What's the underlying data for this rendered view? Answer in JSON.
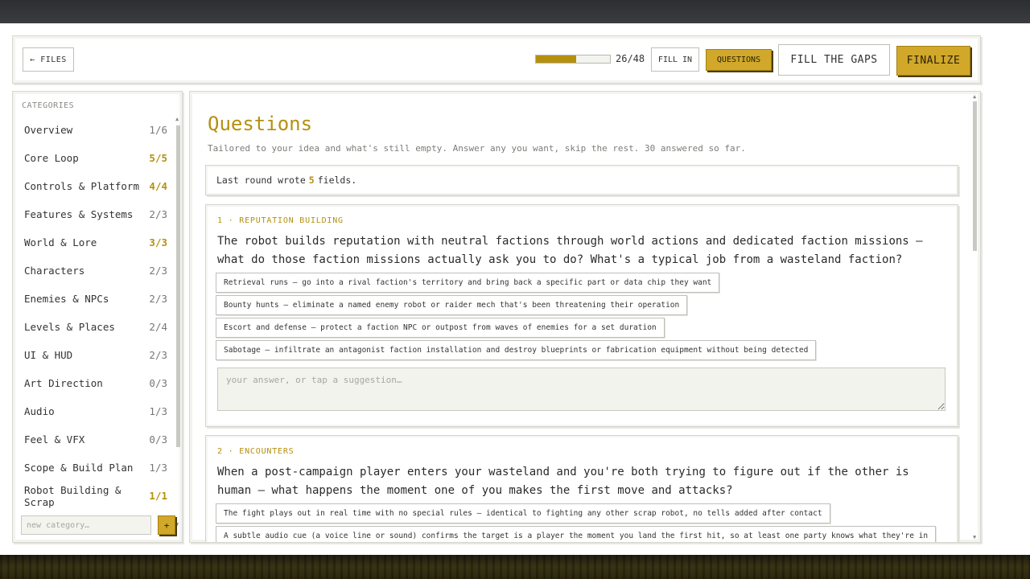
{
  "header": {
    "files_label": "← FILES",
    "progress": {
      "answered": 26,
      "total": 48,
      "label": "26/48",
      "fraction": 0.5417
    },
    "fill_in_label": "FILL IN",
    "questions_label": "QUESTIONS",
    "fill_gaps_label": "FILL THE GAPS",
    "finalize_label": "FINALIZE"
  },
  "colors": {
    "accent": "#d1a82a",
    "accent_text": "#b5900f"
  },
  "sidebar": {
    "title": "CATEGORIES",
    "items": [
      {
        "label": "Overview",
        "count": "1/6",
        "done": false
      },
      {
        "label": "Core Loop",
        "count": "5/5",
        "done": true
      },
      {
        "label": "Controls & Platform",
        "count": "4/4",
        "done": true
      },
      {
        "label": "Features & Systems",
        "count": "2/3",
        "done": false
      },
      {
        "label": "World & Lore",
        "count": "3/3",
        "done": true
      },
      {
        "label": "Characters",
        "count": "2/3",
        "done": false
      },
      {
        "label": "Enemies & NPCs",
        "count": "2/3",
        "done": false
      },
      {
        "label": "Levels & Places",
        "count": "2/4",
        "done": false
      },
      {
        "label": "UI & HUD",
        "count": "2/3",
        "done": false
      },
      {
        "label": "Art Direction",
        "count": "0/3",
        "done": false
      },
      {
        "label": "Audio",
        "count": "1/3",
        "done": false
      },
      {
        "label": "Feel & VFX",
        "count": "0/3",
        "done": false
      },
      {
        "label": "Scope & Build Plan",
        "count": "1/3",
        "done": false
      },
      {
        "label": "Robot Building & Scrap",
        "count": "1/1",
        "done": true
      }
    ],
    "new_category_placeholder": "new category…",
    "add_label": "+"
  },
  "main": {
    "title": "Questions",
    "subtitle": "Tailored to your idea and what's still empty. Answer any you want, skip the rest. 30 answered so far.",
    "last_round": {
      "prefix": "Last round wrote",
      "count": "5",
      "suffix": "fields."
    },
    "questions": [
      {
        "label": "1 · REPUTATION BUILDING",
        "text": "The robot builds reputation with neutral factions through world actions and dedicated faction missions — what do those faction missions actually ask you to do? What's a typical job from a wasteland faction?",
        "suggestions": [
          "Retrieval runs — go into a rival faction's territory and bring back a specific part or data chip they want",
          "Bounty hunts — eliminate a named enemy robot or raider mech that's been threatening their operation",
          "Escort and defense — protect a faction NPC or outpost from waves of enemies for a set duration",
          "Sabotage — infiltrate an antagonist faction installation and destroy blueprints or fabrication equipment without being detected"
        ],
        "answer_placeholder": "your answer, or tap a suggestion…"
      },
      {
        "label": "2 · ENCOUNTERS",
        "text": "When a post-campaign player enters your wasteland and you're both trying to figure out if the other is human — what happens the moment one of you makes the first move and attacks?",
        "suggestions": [
          "The fight plays out in real time with no special rules — identical to fighting any other scrap robot, no tells added after contact",
          "A subtle audio cue (a voice line or sound) confirms the target is a player the moment you land the first hit, so at least one party knows what they're in"
        ]
      }
    ]
  }
}
